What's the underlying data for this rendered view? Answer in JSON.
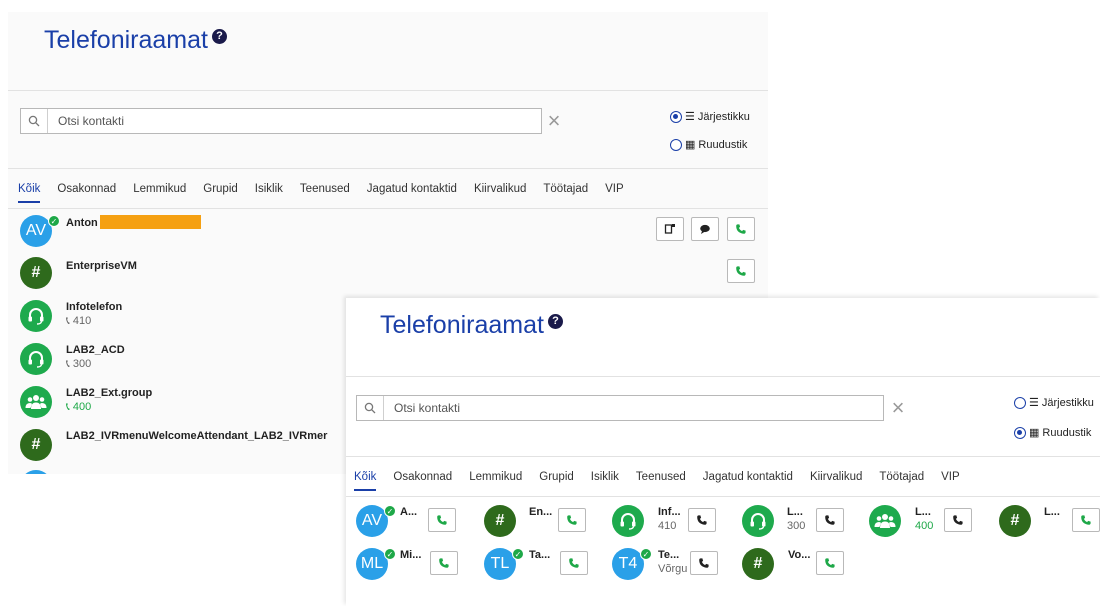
{
  "list_view": {
    "title": "Telefoniraamat",
    "help_symbol": "?",
    "search": {
      "placeholder": "Otsi kontakti",
      "clear": "×"
    },
    "view_options": [
      {
        "label": "Järjestikku",
        "selected": true
      },
      {
        "label": "Ruudustik",
        "selected": false
      }
    ],
    "tabs": [
      "Kõik",
      "Osakonnad",
      "Lemmikud",
      "Grupid",
      "Isiklik",
      "Teenused",
      "Jagatud kontaktid",
      "Kiirvalikud",
      "Töötajad",
      "VIP"
    ],
    "contacts": [
      {
        "initials": "AV",
        "name": "Anton",
        "number": ""
      },
      {
        "initials": "#",
        "name": "EnterpriseVM",
        "number": ""
      },
      {
        "initials": "",
        "name": "Infotelefon",
        "number": "410"
      },
      {
        "initials": "",
        "name": "LAB2_ACD",
        "number": "300"
      },
      {
        "initials": "",
        "name": "LAB2_Ext.group",
        "number": "400"
      },
      {
        "initials": "#",
        "name": "LAB2_IVRmenuWelcomeAttendant_LAB2_IVRmer",
        "number": ""
      }
    ]
  },
  "grid_view": {
    "title": "Telefoniraamat",
    "help_symbol": "?",
    "search": {
      "placeholder": "Otsi kontakti",
      "clear": "×"
    },
    "view_options": [
      {
        "label": "Järjestikku",
        "selected": false
      },
      {
        "label": "Ruudustik",
        "selected": true
      }
    ],
    "tabs": [
      "Kõik",
      "Osakonnad",
      "Lemmikud",
      "Grupid",
      "Isiklik",
      "Teenused",
      "Jagatud kontaktid",
      "Kiirvalikud",
      "Töötajad",
      "VIP"
    ],
    "tiles": [
      {
        "initials": "AV",
        "name": "A...",
        "number": ""
      },
      {
        "initials": "#",
        "name": "En...",
        "number": ""
      },
      {
        "initials": "",
        "name": "Inf...",
        "number": "410"
      },
      {
        "initials": "",
        "name": "L...",
        "number": "300"
      },
      {
        "initials": "",
        "name": "L...",
        "number": "400"
      },
      {
        "initials": "#",
        "name": "L...",
        "number": ""
      },
      {
        "initials": "ML",
        "name": "Mi...",
        "number": ""
      },
      {
        "initials": "TL",
        "name": "Ta...",
        "number": ""
      },
      {
        "initials": "T4",
        "name": "Te...",
        "number": "Võrgu"
      },
      {
        "initials": "#",
        "name": "Vo...",
        "number": ""
      }
    ]
  },
  "colors": {
    "title": "#1a3fa8",
    "avatar_blue": "#2aa0e8",
    "avatar_dark_green": "#2e6a1c",
    "avatar_green": "#1eaa4d",
    "presence_green": "#1ea848",
    "redaction": "#f5a012"
  },
  "icons": {
    "search": "search-icon",
    "clear": "close-icon",
    "call": "phone-icon",
    "chat": "chat-bubble-icon",
    "details": "contact-card-icon",
    "queue": "headset-icon",
    "group": "people-icon",
    "list": "list-icon",
    "grid": "grid-icon"
  }
}
